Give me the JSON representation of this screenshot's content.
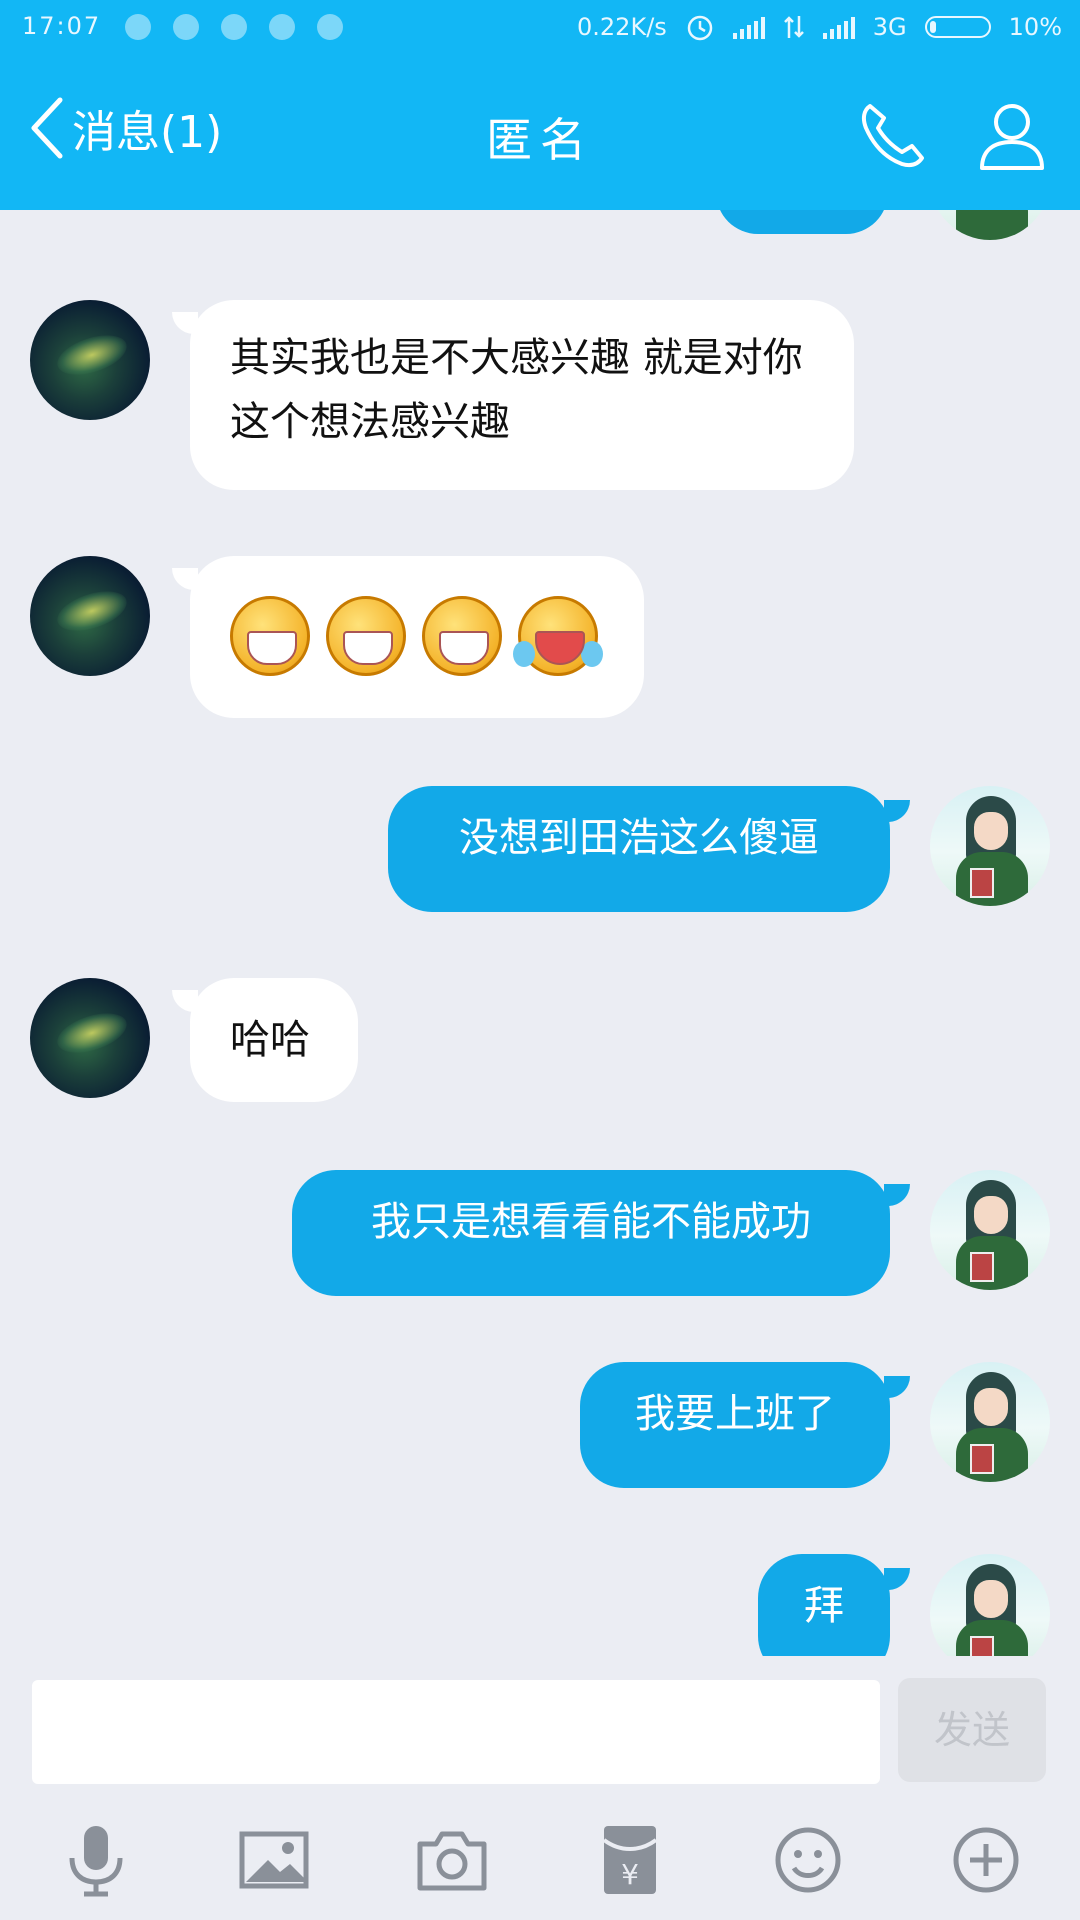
{
  "status_bar": {
    "time": "17:07",
    "net_speed": "0.22K/s",
    "network_type": "3G",
    "battery": "10%"
  },
  "header": {
    "back_label": "消息(1)",
    "title": "匿名"
  },
  "messages": [
    {
      "direction": "incoming",
      "text": "其实我也是不大感兴趣  就是对你这个想法感兴趣"
    },
    {
      "direction": "incoming",
      "emoji": [
        "grin",
        "grin",
        "grin",
        "tears-of-joy"
      ]
    },
    {
      "direction": "outgoing",
      "text": "没想到田浩这么傻逼"
    },
    {
      "direction": "incoming",
      "text": "哈哈"
    },
    {
      "direction": "outgoing",
      "text": "我只是想看看能不能成功"
    },
    {
      "direction": "outgoing",
      "text": "我要上班了"
    },
    {
      "direction": "outgoing",
      "text": "拜"
    }
  ],
  "composer": {
    "input_value": "",
    "send_label": "发送"
  },
  "toolbar": {
    "icons": [
      "microphone-icon",
      "image-icon",
      "camera-icon",
      "red-packet-icon",
      "emoji-icon",
      "plus-icon"
    ]
  },
  "colors": {
    "header_bg": "#12b7f5",
    "outgoing_bubble": "#12a9e8",
    "incoming_bubble": "#ffffff",
    "chat_bg": "#ebedf3"
  }
}
